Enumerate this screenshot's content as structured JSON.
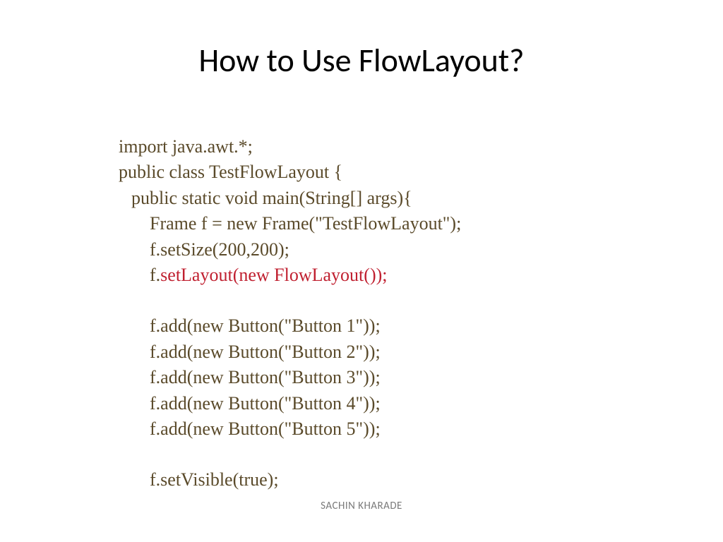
{
  "title": "How to Use FlowLayout?",
  "code": {
    "l1": "import java.awt.*;",
    "l2": "public class TestFlowLayout {",
    "l3": "public static void main(String[] args){",
    "l4": "Frame f = new Frame(\"TestFlowLayout\");",
    "l5": "f.setSize(200,200);",
    "l6a": "f.",
    "l6b": "setLayout(new FlowLayout());",
    "l7": "f.add(new Button(\"Button 1\"));",
    "l8": "f.add(new Button(\"Button 2\"));",
    "l9": "f.add(new Button(\"Button 3\"));",
    "l10": "f.add(new Button(\"Button 4\"));",
    "l11": "f.add(new Button(\"Button 5\"));",
    "l12": "f.setVisible(true);"
  },
  "author": "SACHIN KHARADE"
}
